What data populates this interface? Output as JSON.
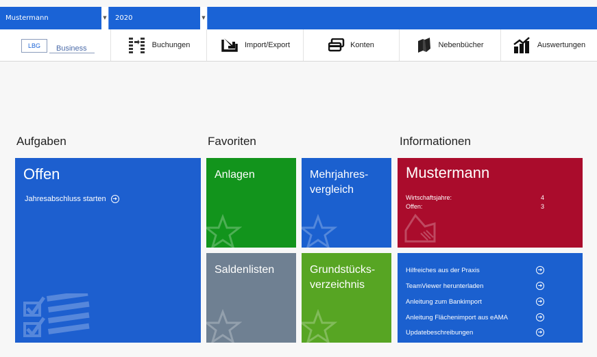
{
  "selectors": {
    "user": "Mustermann",
    "year": "2020"
  },
  "logo": {
    "badge": "LBG",
    "text": "Business"
  },
  "nav": {
    "buchungen": "Buchungen",
    "import_export": "Import/Export",
    "konten": "Konten",
    "nebenbuecher": "Nebenbücher",
    "auswertungen": "Auswertungen"
  },
  "sections": {
    "aufgaben": "Aufgaben",
    "favoriten": "Favoriten",
    "informationen": "Informationen"
  },
  "offen": {
    "title": "Offen",
    "link": "Jahresabschluss starten"
  },
  "favorites": {
    "anlagen": "Anlagen",
    "mehrjahres_line1": "Mehrjahres-",
    "mehrjahres_line2": "vergleich",
    "saldenlisten": "Saldenlisten",
    "grund_line1": "Grundstücks-",
    "grund_line2": "verzeichnis"
  },
  "info": {
    "name": "Mustermann",
    "wirtschaftsjahre_label": "Wirtschaftsjahre:",
    "wirtschaftsjahre_value": "4",
    "offen_label": "Offen:",
    "offen_value": "3",
    "links": [
      "Hilfreiches aus der Praxis",
      "TeamViewer herunterladen",
      "Anleitung zum Bankimport",
      "Anleitung Flächenimport aus eAMA",
      "Updatebeschreibungen"
    ]
  },
  "colors": {
    "blue": "#1b60cf",
    "green": "#12941c",
    "light_green": "#57a523",
    "grey": "#6f8092",
    "red": "#aa0c2c"
  }
}
